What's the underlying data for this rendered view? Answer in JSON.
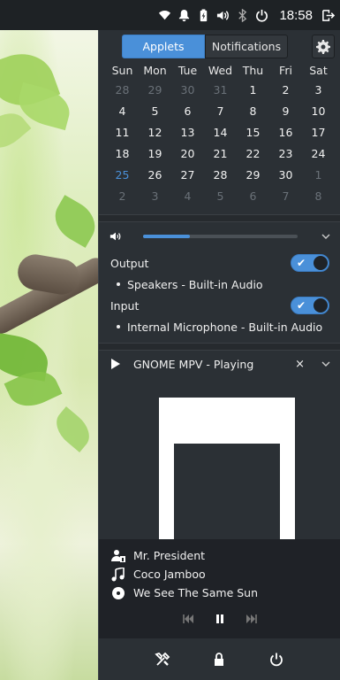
{
  "topbar": {
    "clock": "18:58",
    "tray_icons": [
      "wifi-icon",
      "bell-icon",
      "battery-icon",
      "volume-icon",
      "bluetooth-icon",
      "power-icon",
      "logout-icon"
    ]
  },
  "tabs": [
    {
      "label": "Applets",
      "active": true
    },
    {
      "label": "Notifications",
      "active": false
    }
  ],
  "calendar": {
    "weekdays": [
      "Sun",
      "Mon",
      "Tue",
      "Wed",
      "Thu",
      "Fri",
      "Sat"
    ],
    "weeks": [
      [
        "28",
        "29",
        "30",
        "31",
        "1",
        "2",
        "3"
      ],
      [
        "4",
        "5",
        "6",
        "7",
        "8",
        "9",
        "10"
      ],
      [
        "11",
        "12",
        "13",
        "14",
        "15",
        "16",
        "17"
      ],
      [
        "18",
        "19",
        "20",
        "21",
        "22",
        "23",
        "24"
      ],
      [
        "25",
        "26",
        "27",
        "28",
        "29",
        "30",
        "1"
      ],
      [
        "2",
        "3",
        "4",
        "5",
        "6",
        "7",
        "8"
      ]
    ],
    "today": "25"
  },
  "sound": {
    "volume_percent": 30,
    "output_label": "Output",
    "output_device": "Speakers - Built-in Audio",
    "output_enabled": true,
    "input_label": "Input",
    "input_device": "Internal Microphone - Built-in Audio",
    "input_enabled": true
  },
  "player": {
    "title": "GNOME MPV - Playing",
    "close_glyph": "×",
    "artist": "Mr. President",
    "track": "Coco Jamboo",
    "album": "We See The Same Sun"
  },
  "colors": {
    "accent": "#4a90d9",
    "panel_bg": "#2b3035",
    "topbar_bg": "#1e2225"
  }
}
